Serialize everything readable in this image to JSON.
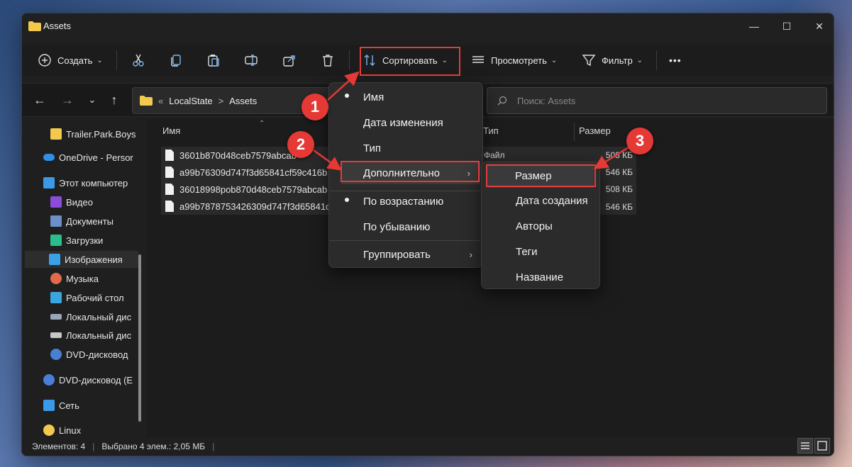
{
  "window": {
    "title": "Assets"
  },
  "toolbar": {
    "create_label": "Создать",
    "sort_label": "Сортировать",
    "view_label": "Просмотреть",
    "filter_label": "Фильтр",
    "more_label": "•••"
  },
  "address": {
    "crumb_prefix": "«",
    "crumbs": [
      "LocalState",
      "Assets"
    ],
    "sep": ">"
  },
  "search": {
    "placeholder": "Поиск: Assets"
  },
  "sidebar": {
    "items": [
      {
        "label": "Trailer.Park.Boys",
        "icon": "folder-icon",
        "color": "#f2c94c"
      },
      {
        "label": "OneDrive - Persor",
        "icon": "cloud-icon",
        "color": "#2f8fe6"
      },
      {
        "label": "Этот компьютер",
        "icon": "monitor-icon",
        "color": "#3a9ae8"
      },
      {
        "label": "Видео",
        "icon": "video-icon",
        "color": "#8a4cd9"
      },
      {
        "label": "Документы",
        "icon": "document-icon",
        "color": "#6a8fc9"
      },
      {
        "label": "Загрузки",
        "icon": "download-icon",
        "color": "#2dbd8c"
      },
      {
        "label": "Изображения",
        "icon": "image-icon",
        "color": "#3aa0e8"
      },
      {
        "label": "Музыка",
        "icon": "music-icon",
        "color": "#e26a4b"
      },
      {
        "label": "Рабочий стол",
        "icon": "desktop-icon",
        "color": "#3aa6e0"
      },
      {
        "label": "Локальный дис",
        "icon": "drive-icon",
        "color": "#9aa5b5"
      },
      {
        "label": "Локальный дис",
        "icon": "drive-icon",
        "color": "#c8c8c8"
      },
      {
        "label": "DVD-дисковод",
        "icon": "dvd-icon",
        "color": "#4a7fd6"
      },
      {
        "label": "DVD-дисковод (E",
        "icon": "dvd-icon",
        "color": "#4a7fd6"
      },
      {
        "label": "Сеть",
        "icon": "network-icon",
        "color": "#3a9ae8"
      },
      {
        "label": "Linux",
        "icon": "linux-icon",
        "color": "#f2c94c"
      }
    ]
  },
  "columns": {
    "name": "Имя",
    "type": "Тип",
    "size": "Размер"
  },
  "files": [
    {
      "name": "3601b870d48ceb7579abcab",
      "size": "508 КБ"
    },
    {
      "name": "a99b76309d747f3d65841cf59c416b",
      "size": "546 КБ"
    },
    {
      "name": "36018998pob870d48ceb7579abcab",
      "size": "508 КБ"
    },
    {
      "name": "a99b7878753426309d747f3d65841c",
      "size": "546 КБ"
    }
  ],
  "file_type": "Файл",
  "status": {
    "count": "Элементов: 4",
    "selected": "Выбрано 4 элем.: 2,05 МБ",
    "bar": "|"
  },
  "sort_menu": {
    "items": [
      "Имя",
      "Дата изменения",
      "Тип",
      "Дополнительно",
      "По возрастанию",
      "По убыванию",
      "Группировать"
    ]
  },
  "more_menu": {
    "items": [
      "Размер",
      "Дата создания",
      "Авторы",
      "Теги",
      "Название"
    ]
  },
  "annotations": {
    "badges": [
      "1",
      "2",
      "3"
    ],
    "color": "#e53935"
  }
}
